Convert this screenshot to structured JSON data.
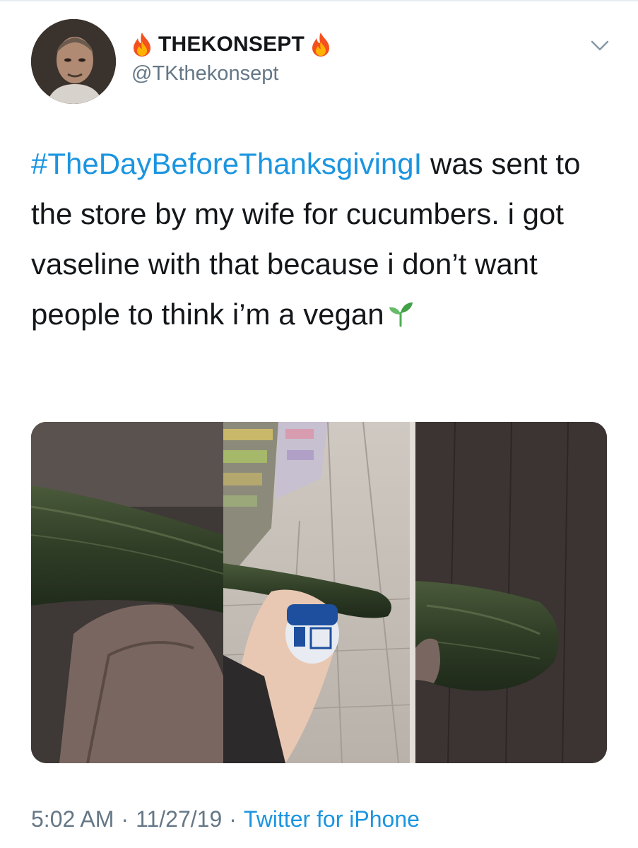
{
  "user": {
    "display_name": "THEKONSEPT",
    "handle": "@TKthekonsept",
    "name_emoji_icon": "fire-icon"
  },
  "tweet": {
    "hashtag": "#TheDayBeforeThanksgivingI",
    "body": " was sent to the store by my wife for cucumbers. i got vaseline with that because i don’t want people to think i’m a vegan",
    "trailing_emoji_icon": "seedling-icon"
  },
  "meta": {
    "time": "5:02 AM",
    "date": "11/27/19",
    "separator": "·",
    "source": "Twitter for iPhone"
  },
  "colors": {
    "link": "#1b95e0",
    "secondary_text": "#657786",
    "primary_text": "#14171a"
  }
}
